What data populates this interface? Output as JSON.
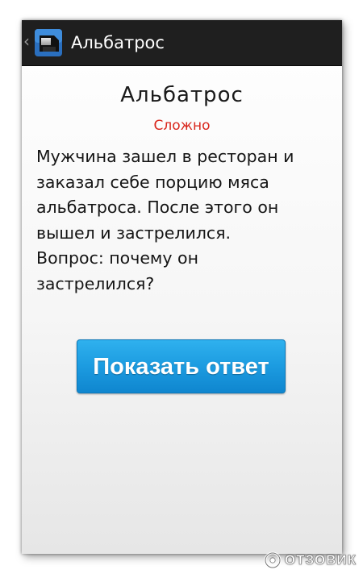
{
  "action_bar": {
    "title": "Альбатрос",
    "app_icon": "riddle-app-icon",
    "up_icon": "chevron-left-icon",
    "up_glyph": "‹"
  },
  "riddle": {
    "title": "Альбатрос",
    "difficulty": "Сложно",
    "text": "Мужчина зашел в ресторан и\nзаказал себе порцию мяса\nальбатроса. После этого он\nвышел и застрелился.\nВопрос: почему он\nзастрелился?",
    "show_answer_label": "Показать ответ"
  },
  "watermark": {
    "text": "ОТЗОВИК",
    "logo_icon": "otzovik-logo-icon"
  },
  "colors": {
    "action_bar_bg": "#1f1f1f",
    "difficulty": "#d9261c",
    "button": "#1c9be0"
  }
}
